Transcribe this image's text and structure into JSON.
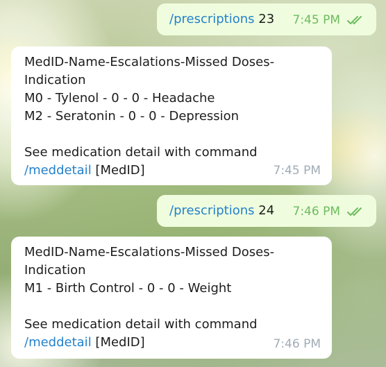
{
  "chat": {
    "messages": [
      {
        "direction": "out",
        "command": "/prescriptions",
        "argument": " 23",
        "time": "7:45 PM",
        "status_icon": "double-check-icon"
      },
      {
        "direction": "in",
        "lines": [
          "MedID-Name-Escalations-Missed Doses-",
          "Indication",
          "M0 - Tylenol - 0 - 0 - Headache",
          "M2 - Seratonin - 0 - 0 - Depression",
          "",
          "See medication detail with command"
        ],
        "command": "/meddetail",
        "command_suffix": " [MedID]",
        "time": "7:45 PM"
      },
      {
        "direction": "out",
        "command": "/prescriptions",
        "argument": " 24",
        "time": "7:46 PM",
        "status_icon": "double-check-icon"
      },
      {
        "direction": "in",
        "lines": [
          "MedID-Name-Escalations-Missed Doses-",
          "Indication",
          "M1 - Birth Control - 0 - 0 - Weight",
          "",
          "See medication detail with command"
        ],
        "command": "/meddetail",
        "command_suffix": " [MedID]",
        "time": "7:46 PM"
      }
    ]
  },
  "colors": {
    "outgoing_bubble": "#effdde",
    "incoming_bubble": "#ffffff",
    "command_link": "#2481cc",
    "outgoing_meta": "#6dbb5e",
    "incoming_meta": "#a0acb6"
  }
}
